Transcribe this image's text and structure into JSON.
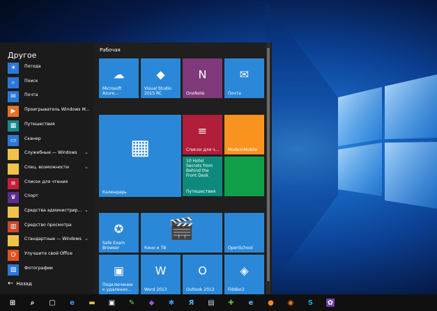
{
  "app_list": {
    "section_title": "Другое",
    "items": [
      {
        "label": "Погода",
        "icon": "weather-sun-icon",
        "color": "#2b78d8",
        "chevron": false
      },
      {
        "label": "Поиск",
        "icon": "search-icon",
        "color": "#2b78d8",
        "chevron": false
      },
      {
        "label": "Почта",
        "icon": "mail-icon",
        "color": "#2b78d8",
        "chevron": false
      },
      {
        "label": "Проигрыватель Windows M...",
        "icon": "media-player-icon",
        "color": "#e57125",
        "chevron": false
      },
      {
        "label": "Путешествия",
        "icon": "travel-suitcase-icon",
        "color": "#178a8c",
        "chevron": false
      },
      {
        "label": "Сканер",
        "icon": "scanner-icon",
        "color": "#2b78d8",
        "chevron": false
      },
      {
        "label": "Служебные — Windows",
        "icon": "folder-icon",
        "color": "#f0c24a",
        "chevron": true
      },
      {
        "label": "Спец. возможности",
        "icon": "folder-icon",
        "color": "#f0c24a",
        "chevron": true
      },
      {
        "label": "Список для чтения",
        "icon": "reading-list-icon",
        "color": "#c41e3a",
        "chevron": false
      },
      {
        "label": "Спорт",
        "icon": "trophy-icon",
        "color": "#5b2d8e",
        "chevron": false
      },
      {
        "label": "Средства администрир...",
        "icon": "folder-icon",
        "color": "#f0c24a",
        "chevron": true
      },
      {
        "label": "Средство просмотра",
        "icon": "reader-icon",
        "color": "#c94a2a",
        "chevron": false
      },
      {
        "label": "Стандартные — Windows",
        "icon": "folder-icon",
        "color": "#f0c24a",
        "chevron": true
      },
      {
        "label": "Улучшите свой Office",
        "icon": "office-icon",
        "color": "#e0531f",
        "chevron": false
      },
      {
        "label": "Фотографии",
        "icon": "photos-icon",
        "color": "#2b78d8",
        "chevron": false
      }
    ],
    "back_label": "Назад"
  },
  "tiles": {
    "group_title": "Рабочая",
    "items": [
      {
        "label": "Microsoft\nAzure...",
        "icon": "azure-icon",
        "color": "#2b88d8"
      },
      {
        "label": "Visual Studio\n2015 RC",
        "icon": "visual-studio-icon",
        "color": "#2b88d8"
      },
      {
        "label": "OneNote",
        "icon": "onenote-icon",
        "color": "#80397b"
      },
      {
        "label": "Почта",
        "icon": "mail-icon",
        "color": "#2b88d8"
      },
      {
        "label": "Календарь",
        "icon": "calendar-icon",
        "color": "#2b88d8"
      },
      {
        "label": "Список для ч...",
        "icon": "reading-list-icon",
        "color": "#b01e3a"
      },
      {
        "label": "ModernMobile",
        "icon": "",
        "color": "#f7931e"
      },
      {
        "label": "10 Hotel\nSecrets from\nBehind the\nFront Desk",
        "icon": "",
        "color": "#0e8a7d"
      },
      {
        "label": "Путешествия",
        "icon": "",
        "color": "#0e8a7d"
      },
      {
        "label": "",
        "icon": "",
        "color": "#10a04a"
      },
      {
        "label": "Safe Exam\nBrowser",
        "icon": "safe-exam-icon",
        "color": "#2b88d8"
      },
      {
        "label": "Кино и ТВ",
        "icon": "film-icon",
        "color": "#2b88d8"
      },
      {
        "label": "OpenSchool",
        "icon": "",
        "color": "#2b88d8"
      },
      {
        "label": "Подключение\nк удаленно...",
        "icon": "remote-desktop-icon",
        "color": "#2b88d8"
      },
      {
        "label": "Word 2013",
        "icon": "word-icon",
        "color": "#2b88d8"
      },
      {
        "label": "Outlook 2013",
        "icon": "outlook-icon",
        "color": "#2b88d8"
      },
      {
        "label": "Fiddler2",
        "icon": "fiddler-icon",
        "color": "#2b88d8"
      }
    ]
  },
  "taskbar": {
    "items": [
      {
        "name": "start-button-windows-icon",
        "glyph": "⊞",
        "bg": "#101010",
        "fg": "#ffffff"
      },
      {
        "name": "search-icon",
        "glyph": "⌕",
        "bg": "#101010",
        "fg": "#ffffff"
      },
      {
        "name": "task-view-icon",
        "glyph": "▢",
        "bg": "#101010",
        "fg": "#ffffff"
      },
      {
        "name": "edge-icon",
        "glyph": "e",
        "bg": "#101010",
        "fg": "#3aa0f0"
      },
      {
        "name": "file-explorer-icon",
        "glyph": "▬",
        "bg": "#101010",
        "fg": "#f0c24a"
      },
      {
        "name": "store-icon",
        "glyph": "▣",
        "bg": "#101010",
        "fg": "#ffffff"
      },
      {
        "name": "notepad-icon",
        "glyph": "✎",
        "bg": "#101010",
        "fg": "#7fd35b"
      },
      {
        "name": "visual-studio-icon",
        "glyph": "◆",
        "bg": "#101010",
        "fg": "#9b59d6"
      },
      {
        "name": "xbox-app-icon",
        "glyph": "✱",
        "bg": "#101010",
        "fg": "#3aa0f0"
      },
      {
        "name": "resharper-icon",
        "glyph": "Я",
        "bg": "#101010",
        "fg": "#4db3ff"
      },
      {
        "name": "network-icon",
        "glyph": "▤",
        "bg": "#101010",
        "fg": "#cfd8e8"
      },
      {
        "name": "puzzle-icon",
        "glyph": "✚",
        "bg": "#101010",
        "fg": "#5bbf4a"
      },
      {
        "name": "internet-explorer-icon",
        "glyph": "e",
        "bg": "#101010",
        "fg": "#5fb7ff"
      },
      {
        "name": "firefox-icon",
        "glyph": "●",
        "bg": "#101010",
        "fg": "#f08a24"
      },
      {
        "name": "media-icon",
        "glyph": "◉",
        "bg": "#101010",
        "fg": "#f07a2a"
      },
      {
        "name": "skype-icon",
        "glyph": "S",
        "bg": "#101010",
        "fg": "#1ea6e8"
      },
      {
        "name": "app-gear-icon",
        "glyph": "✿",
        "bg": "#6b3fb0",
        "fg": "#ffffff"
      }
    ]
  }
}
